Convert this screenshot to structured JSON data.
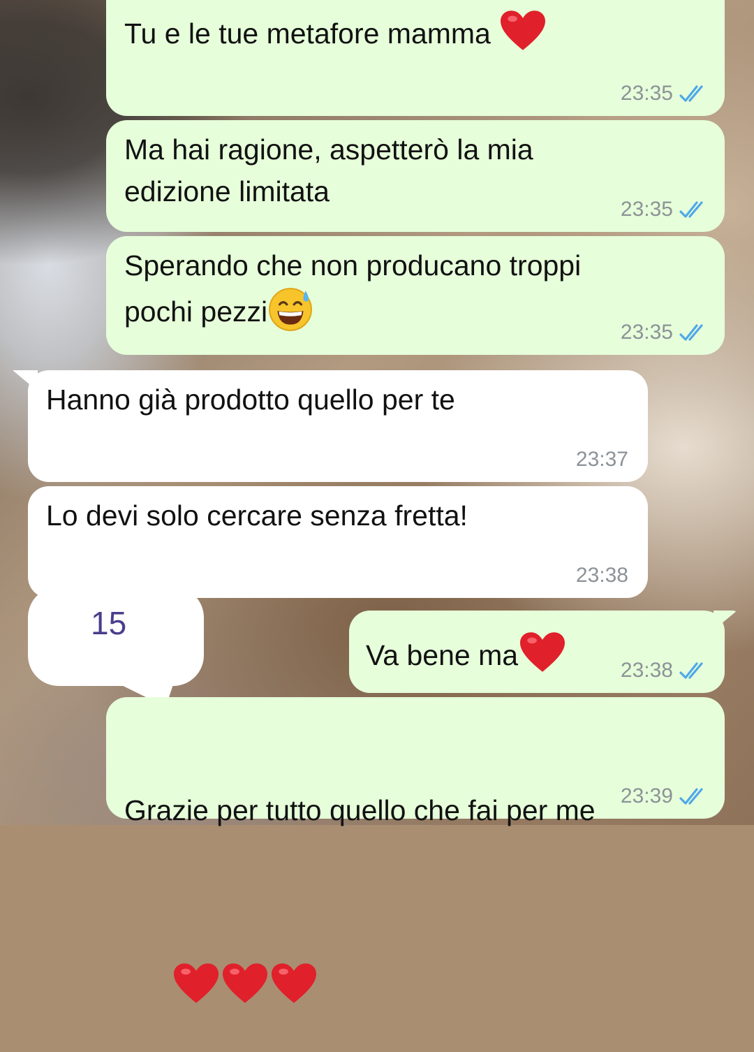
{
  "colors": {
    "outgoing_bubble": "#e6ffda",
    "incoming_bubble": "#ffffff",
    "timestamp": "#8c9297",
    "read_ticks": "#4fa8e8",
    "sticker_text": "#4a3e8c"
  },
  "messages": [
    {
      "direction": "outgoing",
      "text": "Tu e le tue metafore mamma",
      "emoji": "red-heart",
      "time": "23:35",
      "status": "read"
    },
    {
      "direction": "outgoing",
      "text": "Ma hai ragione, aspetterò la mia\nedizione limitata",
      "time": "23:35",
      "status": "read"
    },
    {
      "direction": "outgoing",
      "text": "Sperando che non producano troppi\npochi pezzi",
      "emoji": "grinning-face-with-sweat",
      "time": "23:35",
      "status": "read"
    },
    {
      "direction": "incoming",
      "text": "Hanno già prodotto quello per te",
      "time": "23:37"
    },
    {
      "direction": "incoming",
      "text": "Lo devi solo cercare senza fretta!",
      "time": "23:38"
    },
    {
      "direction": "outgoing",
      "text": "Va bene ma",
      "emoji": "red-heart",
      "time": "23:38",
      "status": "read"
    },
    {
      "direction": "outgoing",
      "text": "Grazie per tutto quello che fai per me",
      "emoji": "red-heart x3",
      "time": "23:39",
      "status": "read"
    }
  ],
  "sticker": {
    "label": "15"
  }
}
